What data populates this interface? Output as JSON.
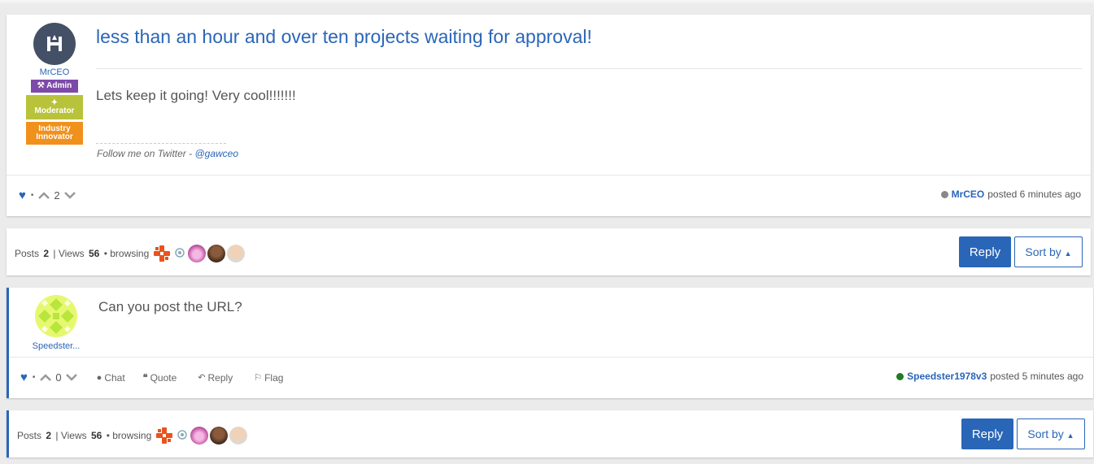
{
  "post1": {
    "author": "MrCEO",
    "badges": [
      "Admin",
      "Moderator",
      "Industry Innovator"
    ],
    "title": "less than an hour and over ten projects waiting for approval!",
    "body": "Lets keep it going! Very cool!!!!!!!",
    "signature_prefix": "Follow me on Twitter - ",
    "signature_link": "@gawceo",
    "votes": "2",
    "posted_by": "MrCEO",
    "posted_time": "posted 6 minutes ago",
    "status_color": "#888888"
  },
  "topic_bar": {
    "posts_label": "Posts",
    "posts_count": "2",
    "views_label": "| Views",
    "views_count": "56",
    "browsing_label": "• browsing",
    "reply_label": "Reply",
    "sort_label": "Sort by"
  },
  "post2": {
    "author": "Speedster...",
    "body": "Can you post the URL?",
    "votes": "0",
    "chat_label": "Chat",
    "quote_label": "Quote",
    "reply_label": "Reply",
    "flag_label": "Flag",
    "posted_by": "Speedster1978v3",
    "posted_time": "posted 5 minutes ago",
    "status_color": "#1e7d22"
  },
  "colors": {
    "accent": "#2a66b8",
    "admin": "#7d4aa8",
    "moderator": "#b8c23b",
    "innovator": "#f0911d"
  }
}
